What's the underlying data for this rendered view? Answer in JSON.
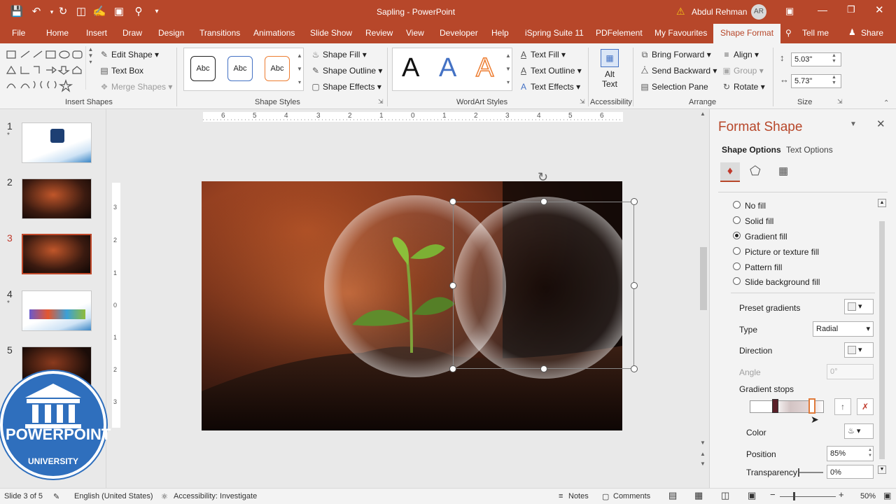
{
  "window": {
    "document_title": "Sapling",
    "app_name": "PowerPoint",
    "separator": " - ",
    "user_name": "Abdul Rehman",
    "user_initials": "AR"
  },
  "tabs": [
    "File",
    "Home",
    "Insert",
    "Draw",
    "Design",
    "Transitions",
    "Animations",
    "Slide Show",
    "Review",
    "View",
    "Developer",
    "Help",
    "iSpring Suite 11",
    "PDFelement",
    "My Favourites",
    "Shape Format",
    "Tell me",
    "Share"
  ],
  "active_tab": "Shape Format",
  "ribbon": {
    "insert_shapes": {
      "label": "Insert Shapes",
      "edit_shape": "Edit Shape",
      "text_box": "Text Box",
      "merge_shapes": "Merge Shapes"
    },
    "shape_styles": {
      "label": "Shape Styles",
      "preset": "Abc",
      "shape_fill": "Shape Fill",
      "shape_outline": "Shape Outline",
      "shape_effects": "Shape Effects"
    },
    "wordart": {
      "label": "WordArt Styles",
      "letter": "A",
      "text_fill": "Text Fill",
      "text_outline": "Text Outline",
      "text_effects": "Text Effects"
    },
    "accessibility": {
      "label": "Accessibility",
      "alt_text_line1": "Alt",
      "alt_text_line2": "Text"
    },
    "arrange": {
      "label": "Arrange",
      "bring_forward": "Bring Forward",
      "send_backward": "Send Backward",
      "selection_pane": "Selection Pane",
      "align": "Align",
      "group": "Group",
      "rotate": "Rotate"
    },
    "size": {
      "label": "Size",
      "height": "5.03\"",
      "width": "5.73\""
    }
  },
  "thumbnails": [
    {
      "num": "1",
      "star": "*"
    },
    {
      "num": "2",
      "star": ""
    },
    {
      "num": "3",
      "star": ""
    },
    {
      "num": "4",
      "star": "*"
    },
    {
      "num": "5",
      "star": ""
    }
  ],
  "active_slide": "3",
  "ruler": {
    "h_labels": [
      "6",
      "5",
      "4",
      "3",
      "2",
      "1",
      "0",
      "1",
      "2",
      "3",
      "4",
      "5",
      "6"
    ],
    "v_labels": [
      "3",
      "2",
      "1",
      "0",
      "1",
      "2",
      "3"
    ]
  },
  "watermark": {
    "line1": "POWERPOINT",
    "line2": "UNIVERSITY"
  },
  "format_pane": {
    "title": "Format Shape",
    "tab_shape_options": "Shape Options",
    "tab_text_options": "Text Options",
    "fill_options": [
      "No fill",
      "Solid fill",
      "Gradient fill",
      "Picture or texture fill",
      "Pattern fill",
      "Slide background fill"
    ],
    "selected_fill": "Gradient fill",
    "preset_gradients": "Preset gradients",
    "type_label": "Type",
    "type_value": "Radial",
    "direction_label": "Direction",
    "angle_label": "Angle",
    "angle_value": "0°",
    "gradient_stops_label": "Gradient stops",
    "color_label": "Color",
    "position_label": "Position",
    "position_value": "85%",
    "transparency_label": "Transparency",
    "transparency_value": "0%"
  },
  "status": {
    "slide_info": "Slide 3 of 5",
    "language": "English (United States)",
    "accessibility": "Accessibility: Investigate",
    "notes": "Notes",
    "comments": "Comments",
    "zoom": "50%"
  },
  "colors": {
    "accent": "#b7472a",
    "ribbon": "#f3f3f3"
  }
}
